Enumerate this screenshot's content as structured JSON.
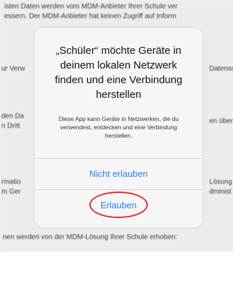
{
  "background": {
    "top_lines": [
      "isten Daten werden vom MDM-Anbieter Ihrer Schule ver",
      "essern. Der MDM-Anbieter hat keinen Zugriff auf Inform"
    ],
    "left_fragments": [
      "ur Verw",
      "den Da",
      "n Dritt",
      "rmatio",
      "m Ger"
    ],
    "right_fragments": [
      "Datensc",
      "en über",
      "Lösung",
      "dminist"
    ],
    "bottom_line": "nen werden von der MDM-Lösung Ihrer Schule erhoben:"
  },
  "alert": {
    "title": "„Schüler“ möchte Geräte in deinem lokalen Netzwerk finden und eine Verbindung herstellen",
    "message": "Diese App kann Geräte in Netzwerken, die du verwendest, entdecken und eine Verbindung herstellen.",
    "deny_label": "Nicht erlauben",
    "allow_label": "Erlauben"
  },
  "colors": {
    "accent": "#2f7bf0",
    "highlight": "#e0272a"
  }
}
